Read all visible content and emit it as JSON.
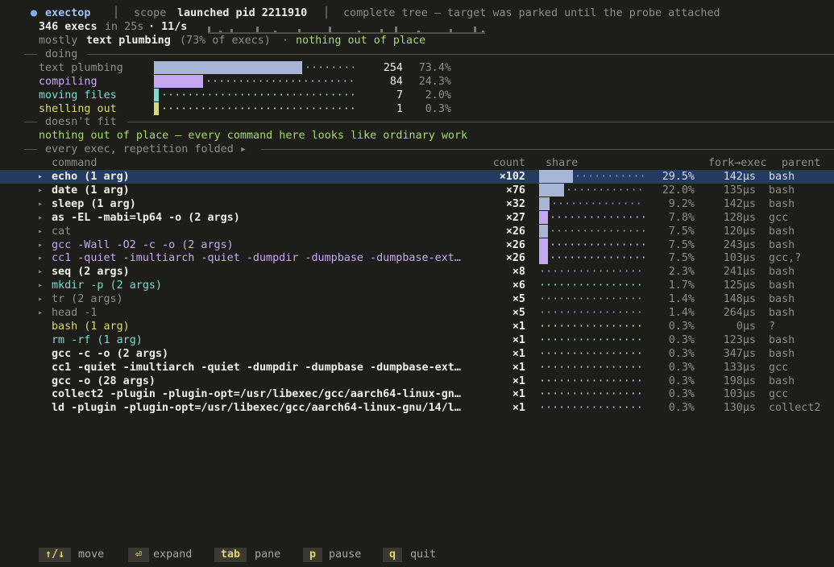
{
  "header": {
    "app_icon": "status-dot-icon",
    "app_name": "exectop",
    "scope_label": "scope",
    "scope_value": "launched pid 2211910",
    "tree_status": "complete tree — target was parked until the probe attached",
    "exec_count": "346 execs",
    "duration": "in 25s",
    "rate": "· 11/s",
    "summary_lead": "mostly",
    "summary_category": "text plumbing",
    "summary_pct": "(73% of execs)",
    "summary_sep": "·",
    "summary_verdict": "nothing out of place"
  },
  "sections": {
    "doing": "doing",
    "doesnt_fit": "doesn't fit",
    "every_exec": "every exec, repetition folded ▸"
  },
  "doing": [
    {
      "label": "text plumbing",
      "count": "254",
      "pct": "73.4%",
      "fraction": 0.734,
      "color": "#a7b6d6",
      "label_class": "dim"
    },
    {
      "label": "compiling",
      "count": "84",
      "pct": "24.3%",
      "fraction": 0.243,
      "color": "#c5a7f2",
      "label_class": "pur"
    },
    {
      "label": "moving files",
      "count": "7",
      "pct": "2.0%",
      "fraction": 0.02,
      "color": "#7ddbcf",
      "label_class": "teal"
    },
    {
      "label": "shelling out",
      "count": "1",
      "pct": "0.3%",
      "fraction": 0.003,
      "color": "#d9d97a",
      "label_class": "yel"
    }
  ],
  "doesnt_fit_msg": "nothing out of place — every command here looks like ordinary work",
  "table": {
    "headers": {
      "command": "command",
      "count": "count",
      "share": "share",
      "fork": "fork→exec",
      "parent": "parent"
    },
    "rows": [
      {
        "tri": "▸",
        "cmd": "echo (1 arg)",
        "cls": "w b",
        "count": "×102",
        "pct": "29.5%",
        "fraction": 0.295,
        "bar": "#a7b6d6",
        "fork": "142µs",
        "parent": "bash",
        "selected": true
      },
      {
        "tri": "▸",
        "cmd": "date (1 arg)",
        "cls": "w b",
        "count": "×76",
        "pct": "22.0%",
        "fraction": 0.22,
        "bar": "#a7b6d6",
        "fork": "135µs",
        "parent": "bash"
      },
      {
        "tri": "▸",
        "cmd": "sleep (1 arg)",
        "cls": "w b",
        "count": "×32",
        "pct": "9.2%",
        "fraction": 0.092,
        "bar": "#a7b6d6",
        "fork": "142µs",
        "parent": "bash"
      },
      {
        "tri": "▸",
        "cmd": "as -EL -mabi=lp64 -o (2 args)",
        "cls": "w b",
        "count": "×27",
        "pct": "7.8%",
        "fraction": 0.078,
        "bar": "#c5a7f2",
        "fork": "128µs",
        "parent": "gcc"
      },
      {
        "tri": "▸",
        "cmd": "cat",
        "cls": "dim",
        "count": "×26",
        "pct": "7.5%",
        "fraction": 0.075,
        "bar": "#a7b6d6",
        "fork": "120µs",
        "parent": "bash"
      },
      {
        "tri": "▸",
        "cmd": "gcc -Wall -O2 -c -o (2 args)",
        "cls": "pur",
        "count": "×26",
        "pct": "7.5%",
        "fraction": 0.075,
        "bar": "#c5a7f2",
        "fork": "243µs",
        "parent": "bash"
      },
      {
        "tri": "▸",
        "cmd": "cc1 -quiet -imultiarch -quiet -dumpdir -dumpbase -dumpbase-ext…",
        "cls": "pur",
        "count": "×26",
        "pct": "7.5%",
        "fraction": 0.075,
        "bar": "#c5a7f2",
        "fork": "103µs",
        "parent": "gcc,?"
      },
      {
        "tri": "▸",
        "cmd": "seq (2 args)",
        "cls": "w b",
        "count": "×8",
        "pct": "2.3%",
        "fraction": 0.023,
        "bar": "#a7b6d6",
        "fork": "241µs",
        "parent": "bash"
      },
      {
        "tri": "▸",
        "cmd": "mkdir -p (2 args)",
        "cls": "teal",
        "count": "×6",
        "pct": "1.7%",
        "fraction": 0.017,
        "bar": "#7ddbcf",
        "fork": "125µs",
        "parent": "bash"
      },
      {
        "tri": "▸",
        "cmd": "tr (2 args)",
        "cls": "dim",
        "count": "×5",
        "pct": "1.4%",
        "fraction": 0.014,
        "bar": "#a7b6d6",
        "fork": "148µs",
        "parent": "bash"
      },
      {
        "tri": "▸",
        "cmd": "head -1",
        "cls": "dim",
        "count": "×5",
        "pct": "1.4%",
        "fraction": 0.014,
        "bar": "#a7b6d6",
        "fork": "264µs",
        "parent": "bash"
      },
      {
        "tri": "",
        "cmd": "bash (1 arg)",
        "cls": "yel",
        "count": "×1",
        "pct": "0.3%",
        "fraction": 0.003,
        "bar": "#d9d97a",
        "fork": "0µs",
        "parent": "?"
      },
      {
        "tri": "",
        "cmd": "rm -rf (1 arg)",
        "cls": "teal",
        "count": "×1",
        "pct": "0.3%",
        "fraction": 0.003,
        "bar": "#7ddbcf",
        "fork": "123µs",
        "parent": "bash"
      },
      {
        "tri": "",
        "cmd": "gcc -c -o (2 args)",
        "cls": "w b",
        "count": "×1",
        "pct": "0.3%",
        "fraction": 0.003,
        "bar": "#c5a7f2",
        "fork": "347µs",
        "parent": "bash"
      },
      {
        "tri": "",
        "cmd": "cc1 -quiet -imultiarch -quiet -dumpdir -dumpbase -dumpbase-ext…",
        "cls": "w b",
        "count": "×1",
        "pct": "0.3%",
        "fraction": 0.003,
        "bar": "#c5a7f2",
        "fork": "133µs",
        "parent": "gcc"
      },
      {
        "tri": "",
        "cmd": "gcc -o (28 args)",
        "cls": "w b",
        "count": "×1",
        "pct": "0.3%",
        "fraction": 0.003,
        "bar": "#c5a7f2",
        "fork": "198µs",
        "parent": "bash"
      },
      {
        "tri": "",
        "cmd": "collect2 -plugin -plugin-opt=/usr/libexec/gcc/aarch64-linux-gn…",
        "cls": "w b",
        "count": "×1",
        "pct": "0.3%",
        "fraction": 0.003,
        "bar": "#c5a7f2",
        "fork": "103µs",
        "parent": "gcc"
      },
      {
        "tri": "",
        "cmd": "ld -plugin -plugin-opt=/usr/libexec/gcc/aarch64-linux-gnu/14/l…",
        "cls": "w b",
        "count": "×1",
        "pct": "0.3%",
        "fraction": 0.003,
        "bar": "#c5a7f2",
        "fork": "130µs",
        "parent": "collect2"
      }
    ]
  },
  "footer": {
    "keys": [
      {
        "key": "↑/↓",
        "label": "move",
        "name": "move"
      },
      {
        "key": "⏎",
        "label": "expand",
        "name": "expand"
      },
      {
        "key": "tab",
        "label": "pane",
        "name": "pane"
      },
      {
        "key": "p",
        "label": "pause",
        "name": "pause"
      },
      {
        "key": "q",
        "label": "quit",
        "name": "quit"
      }
    ]
  },
  "colors": {
    "background": "#1d1d19",
    "selection": "#243b63",
    "dots": "#5e7cc4",
    "accent_green": "#a9d96a"
  }
}
